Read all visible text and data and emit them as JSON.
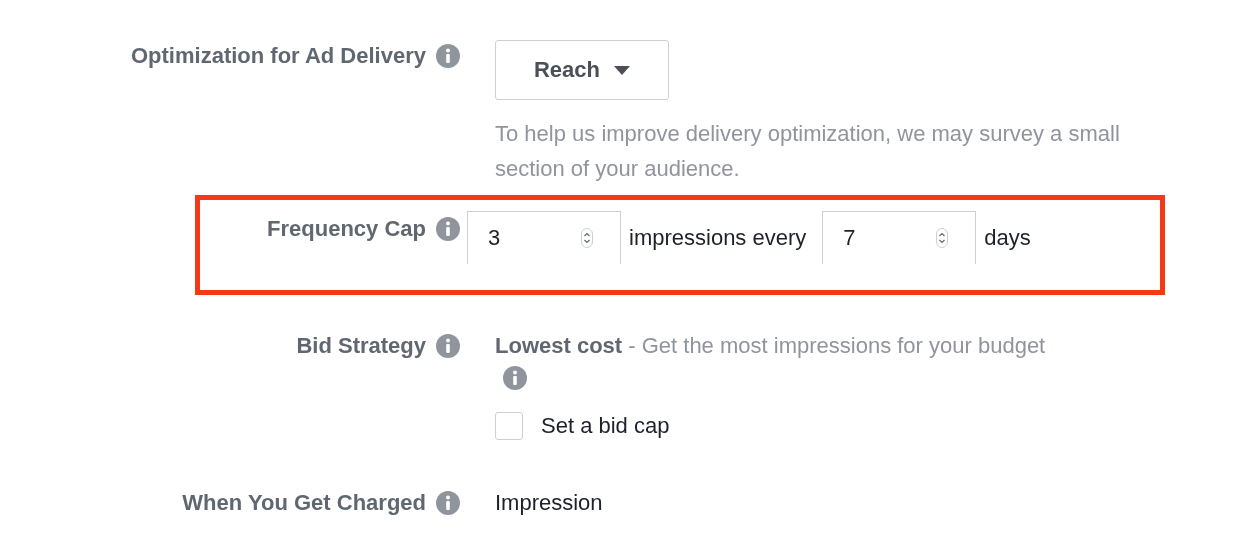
{
  "settings": [
    {
      "kind": "dropdown",
      "label": "Optimization for Ad Delivery",
      "value": "Reach",
      "hint": "To help us improve delivery optimization, we may survey a small section of your audience."
    },
    {
      "kind": "frequency",
      "label": "Frequency Cap",
      "highlighted": true,
      "impressions": "3",
      "impressions_text": "impressions every",
      "days": "7",
      "days_text": "days"
    },
    {
      "kind": "bid",
      "label": "Bid Strategy",
      "strategy": "Lowest cost",
      "description": "- Get the most impressions for your budget",
      "checkbox": {
        "label": "Set a bid cap",
        "checked": false
      }
    },
    {
      "kind": "charged",
      "label": "When You Get Charged",
      "value": "Impression"
    }
  ]
}
